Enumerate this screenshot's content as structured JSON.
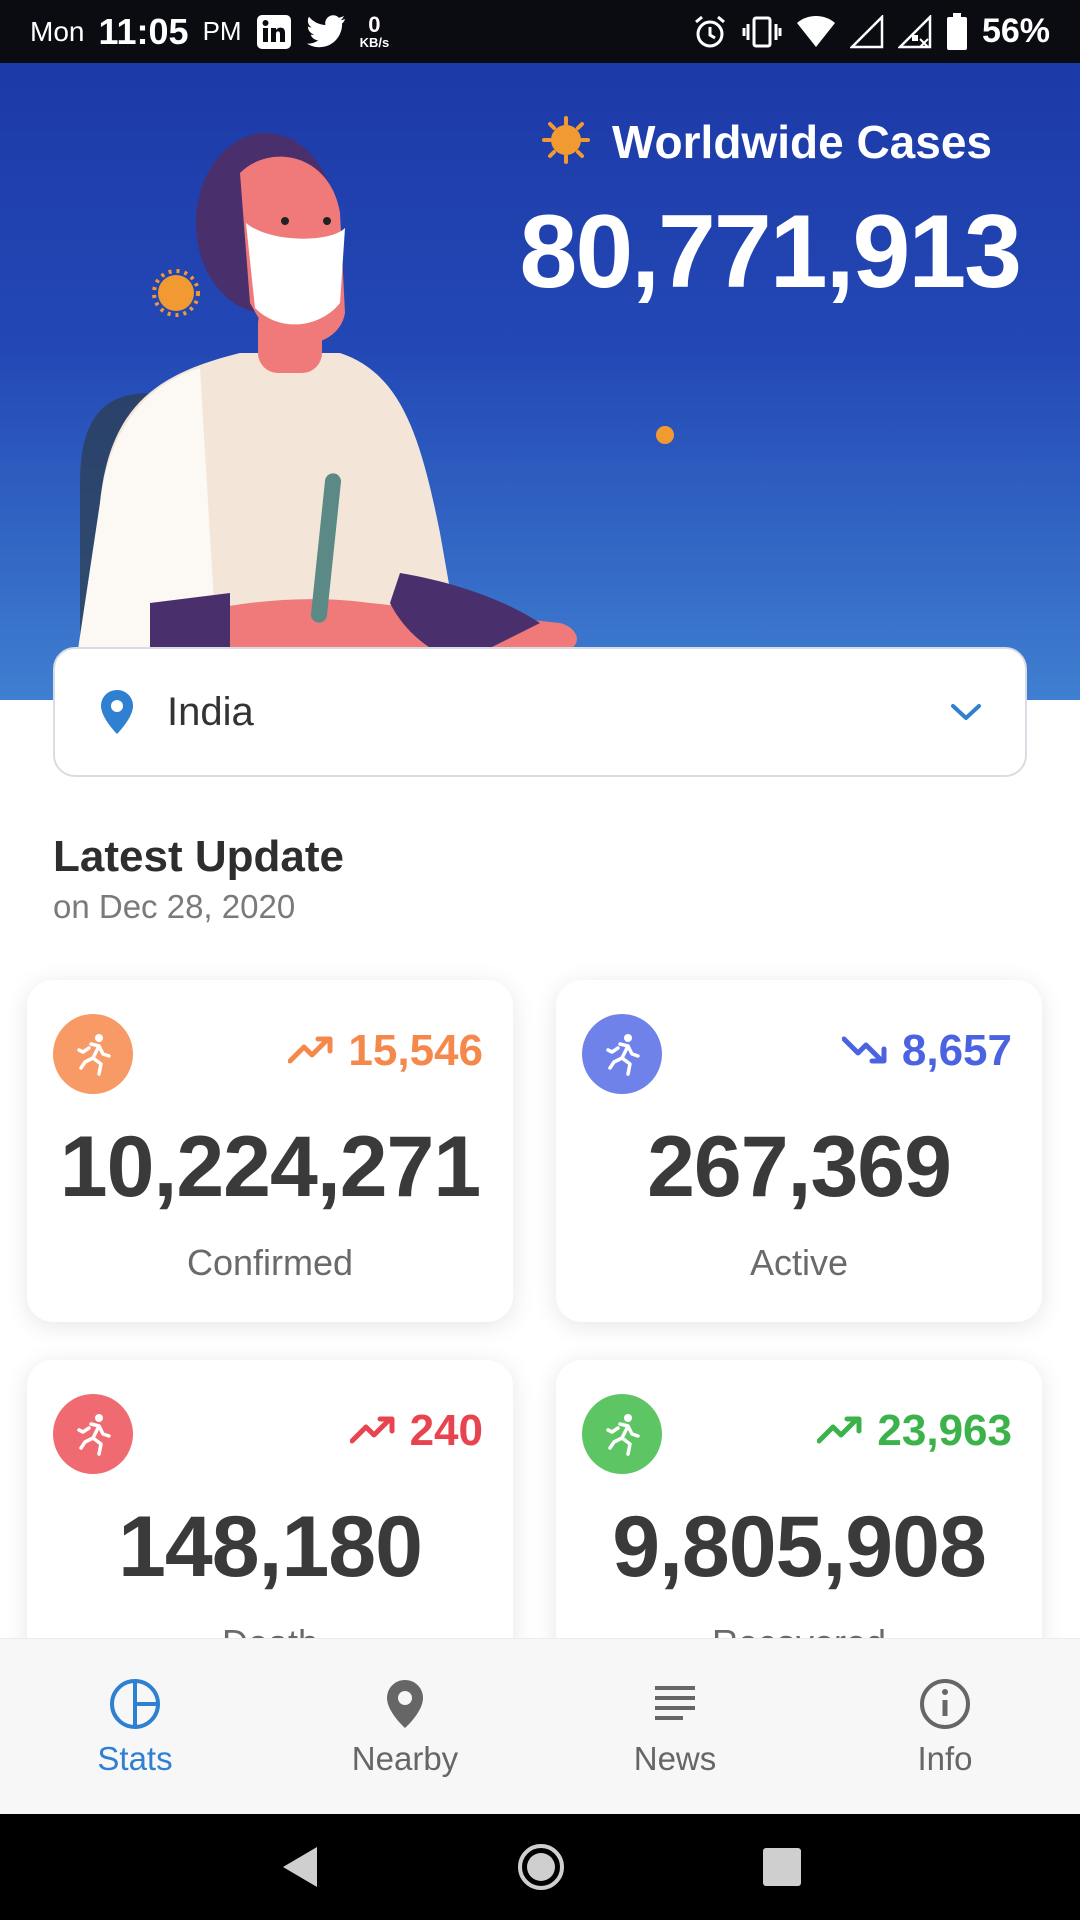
{
  "status_bar": {
    "day": "Mon",
    "time": "11:05",
    "ampm": "PM",
    "net_speed_value": "0",
    "net_speed_unit": "KB/s",
    "battery": "56%"
  },
  "hero": {
    "title": "Worldwide Cases",
    "count": "80,771,913"
  },
  "country_select": {
    "selected": "India"
  },
  "latest": {
    "title": "Latest Update",
    "date": "on Dec 28, 2020"
  },
  "cards": [
    {
      "label": "Confirmed",
      "value": "10,224,271",
      "delta": "15,546",
      "trend": "up",
      "color": "#f5894c",
      "icon_bg": "#f89a65"
    },
    {
      "label": "Active",
      "value": "267,369",
      "delta": "8,657",
      "trend": "down",
      "color": "#4b63e0",
      "icon_bg": "#6f82ea"
    },
    {
      "label": "Death",
      "value": "148,180",
      "delta": "240",
      "trend": "up",
      "color": "#e84450",
      "icon_bg": "#f06a72"
    },
    {
      "label": "Recovered",
      "value": "9,805,908",
      "delta": "23,963",
      "trend": "up",
      "color": "#3bb34a",
      "icon_bg": "#5ec564"
    }
  ],
  "bottom_nav": [
    {
      "label": "Stats",
      "icon": "pie-chart-icon",
      "active": true
    },
    {
      "label": "Nearby",
      "icon": "location-pin-icon",
      "active": false
    },
    {
      "label": "News",
      "icon": "news-lines-icon",
      "active": false
    },
    {
      "label": "Info",
      "icon": "info-circle-icon",
      "active": false
    }
  ],
  "colors": {
    "accent": "#2f80d1",
    "hero_top": "#1c3aa8",
    "hero_bottom": "#3f7fd1"
  }
}
